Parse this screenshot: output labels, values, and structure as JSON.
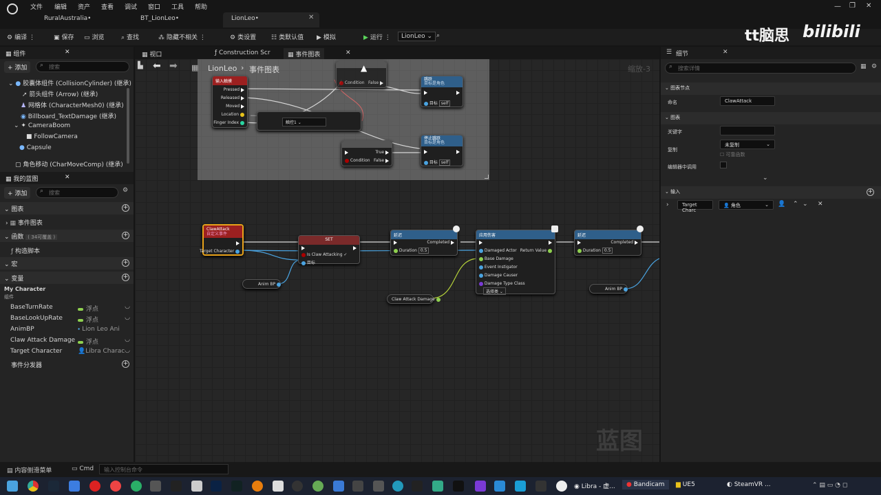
{
  "menu": [
    "文件",
    "编辑",
    "资产",
    "查看",
    "调试",
    "窗口",
    "工具",
    "帮助"
  ],
  "doc_tabs": [
    {
      "label": "RuralAustralia•"
    },
    {
      "label": "BT_LionLeo•"
    },
    {
      "label": "LionLeo•",
      "active": true
    }
  ],
  "watermark": {
    "brand": "tt脑思",
    "site": "bilibili",
    "corner": "蓝图"
  },
  "toolbar": {
    "compile": "编译",
    "save": "保存",
    "browse": "浏览",
    "find": "查找",
    "hide_unrelated": "隐藏不相关",
    "class_settings": "类设置",
    "class_defaults": "类默认值",
    "simulate": "模拟",
    "run": "运行",
    "debug_object": "LionLeo"
  },
  "components_panel": {
    "title": "组件",
    "add": "添加",
    "search_placeholder": "搜索",
    "items": [
      "胶囊体组件 (CollisionCylinder) (继承)",
      "箭头组件 (Arrow) (继承)",
      "网格体 (CharacterMesh0) (继承)",
      "Billboard_TextDamage (继承)",
      "CameraBoom",
      "FollowCamera",
      "Capsule",
      "角色移动 (CharMoveComp) (继承)"
    ]
  },
  "myblueprint": {
    "title": "我的蓝图",
    "add": "添加",
    "search_placeholder": "搜索",
    "sections": {
      "graphs": "图表",
      "event_graph": "事件图表",
      "functions": "函数",
      "functions_count": "( 34可覆盖 )",
      "construction": "构造脚本",
      "macros": "宏",
      "variables": "变量",
      "dispatchers": "事件分发器"
    },
    "var_category": "My Character",
    "var_sub": "组件",
    "variables": [
      {
        "name": "BaseTurnRate",
        "type": "浮点",
        "color": "#8fd14f"
      },
      {
        "name": "BaseLookUpRate",
        "type": "浮点",
        "color": "#8fd14f"
      },
      {
        "name": "AnimBP",
        "type": "Lion Leo Ani",
        "color": "#4aa3e0"
      },
      {
        "name": "Claw Attack Damage",
        "type": "浮点",
        "color": "#8fd14f"
      },
      {
        "name": "Target Character",
        "type": "Libra Charac",
        "color": "#4aa3e0"
      }
    ]
  },
  "graph_tabs": [
    {
      "label": "视口"
    },
    {
      "label": "Construction Scr"
    },
    {
      "label": "事件图表",
      "active": true
    }
  ],
  "breadcrumb": {
    "root": "LionLeo",
    "current": "事件图表",
    "zoom": "缩放-3"
  },
  "nodes": {
    "input_touch": {
      "title": "输入触摸",
      "header_ghost": "Touch Input",
      "pins": [
        "Pressed",
        "Released",
        "Moved",
        "Location",
        "Finger Index"
      ]
    },
    "branch_top": {
      "pins": [
        "Condition",
        "True",
        "False"
      ]
    },
    "jump": {
      "title": "跳跃",
      "sub": "目标是角色",
      "target": "目标",
      "self": "self"
    },
    "stop_jump": {
      "title": "停止跳跃",
      "sub": "目标是角色",
      "target": "目标",
      "self": "self"
    },
    "branch_mid": {
      "pins": [
        "Condition",
        "True",
        "False"
      ]
    },
    "select_value": "触控1",
    "claw_attack": {
      "title": "ClawAttack",
      "sub": "自定义事件",
      "pin": "Target Character"
    },
    "set": {
      "title": "SET",
      "pin1": "Is Claw Attacking",
      "pin2": "目标"
    },
    "delay1": {
      "title": "延迟",
      "completed": "Completed",
      "duration": "Duration",
      "value": "0.5"
    },
    "apply_damage": {
      "title": "应用伤害",
      "pins": [
        "Damaged Actor",
        "Base Damage",
        "Event Instigator",
        "Damage Causer",
        "Damage Type Class"
      ],
      "ret": "Return Value",
      "select": "选择类"
    },
    "delay2": {
      "title": "延迟",
      "completed": "Completed",
      "duration": "Duration",
      "value": "0.5"
    },
    "anim_bp1": "Anim BP",
    "anim_bp2": "Anim BP",
    "claw_damage": "Claw Attack Damage"
  },
  "details": {
    "title": "细节",
    "search_placeholder": "搜索详情",
    "graph_node_section": "图表节点",
    "name_label": "命名",
    "name_value": "ClawAttack",
    "graph_section": "图表",
    "keyword_label": "关键字",
    "replicate_label": "复制",
    "replicate_value": "未复制",
    "reliable": "可靠函数",
    "call_in_editor": "编辑器中调用",
    "inputs_section": "输入",
    "input_name": "Target Charc",
    "input_type": "角色"
  },
  "status": {
    "drawer": "内容侧滑菜单",
    "cmd": "Cmd",
    "console_placeholder": "输入控制台命令"
  },
  "taskbar": [
    {
      "label": "Libra - 虚..."
    },
    {
      "label": "Bandicam"
    },
    {
      "label": "UE5"
    },
    {
      "label": "SteamVR ..."
    }
  ]
}
